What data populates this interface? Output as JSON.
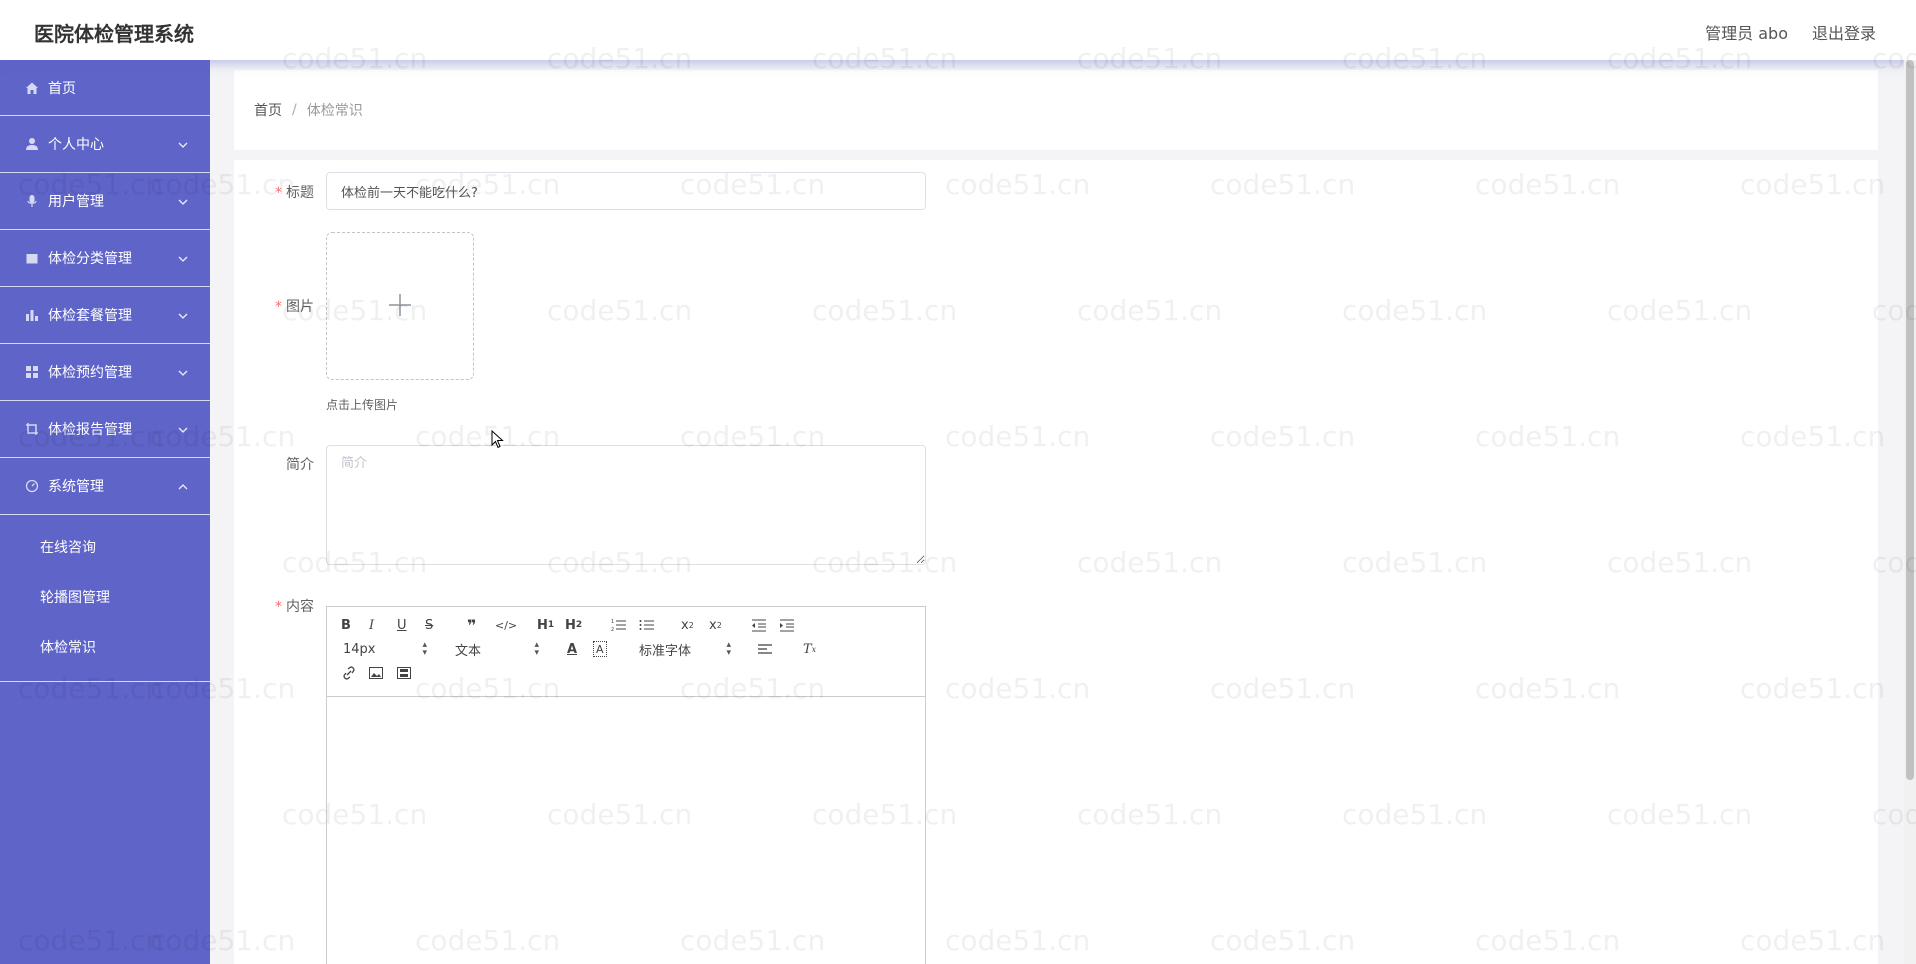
{
  "app": {
    "title": "医院体检管理系统"
  },
  "header": {
    "user_label": "管理员 abo",
    "logout_label": "退出登录"
  },
  "sidebar": {
    "items": [
      {
        "label": "首页",
        "icon": "home-icon"
      },
      {
        "label": "个人中心",
        "icon": "user-icon"
      },
      {
        "label": "用户管理",
        "icon": "microphone-icon"
      },
      {
        "label": "体检分类管理",
        "icon": "box-icon"
      },
      {
        "label": "体检套餐管理",
        "icon": "bar-chart-icon"
      },
      {
        "label": "体检预约管理",
        "icon": "grid-icon"
      },
      {
        "label": "体检报告管理",
        "icon": "crop-icon"
      },
      {
        "label": "系统管理",
        "icon": "gauge-icon"
      }
    ],
    "submenu": [
      "在线咨询",
      "轮播图管理",
      "体检常识"
    ]
  },
  "breadcrumb": {
    "home": "首页",
    "separator": "/",
    "current": "体检常识"
  },
  "form": {
    "title_label": "标题",
    "title_value": "体检前一天不能吃什么?",
    "image_label": "图片",
    "upload_tip": "点击上传图片",
    "intro_label": "简介",
    "intro_placeholder": "简介",
    "content_label": "内容"
  },
  "editor": {
    "font_size": "14px",
    "header_select": "文本",
    "font_family": "标准字体",
    "tools_row1": [
      "bold-icon",
      "italic-icon",
      "underline-icon",
      "strike-icon",
      "blockquote-icon",
      "code-icon",
      "h1-icon",
      "h2-icon",
      "ordered-list-icon",
      "bullet-list-icon",
      "subscript-icon",
      "superscript-icon",
      "outdent-icon",
      "indent-icon"
    ],
    "tools_row2": [
      "font-color-icon",
      "background-color-icon",
      "align-icon",
      "clear-format-icon"
    ],
    "tools_row3": [
      "link-icon",
      "image-icon",
      "video-icon"
    ]
  },
  "watermark": "code51.cn",
  "colors": {
    "sidebar": "#5f64c8",
    "required": "#f56c6c"
  }
}
